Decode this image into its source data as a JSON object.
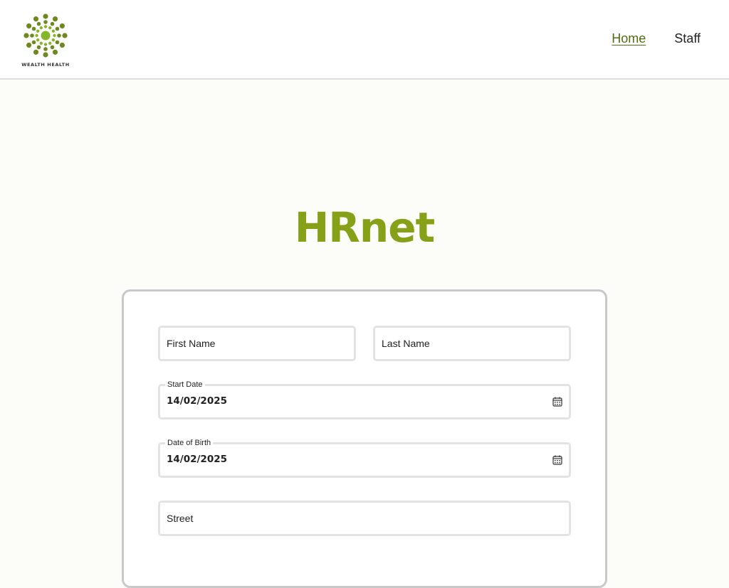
{
  "brand": {
    "logo_text": "WEALTH HEALTH",
    "accent_color": "#86a017",
    "logo_color": "#6e8a1f"
  },
  "nav": {
    "items": [
      {
        "label": "Home",
        "active": true
      },
      {
        "label": "Staff",
        "active": false
      }
    ]
  },
  "page": {
    "title": "HRnet"
  },
  "form": {
    "first_name": {
      "placeholder": "First Name",
      "value": ""
    },
    "last_name": {
      "placeholder": "Last Name",
      "value": ""
    },
    "start_date": {
      "label": "Start Date",
      "value": "14/02/2025",
      "icon": "calendar-icon"
    },
    "date_of_birth": {
      "label": "Date of Birth",
      "value": "14/02/2025",
      "icon": "calendar-icon"
    },
    "street": {
      "placeholder": "Street",
      "value": ""
    }
  }
}
